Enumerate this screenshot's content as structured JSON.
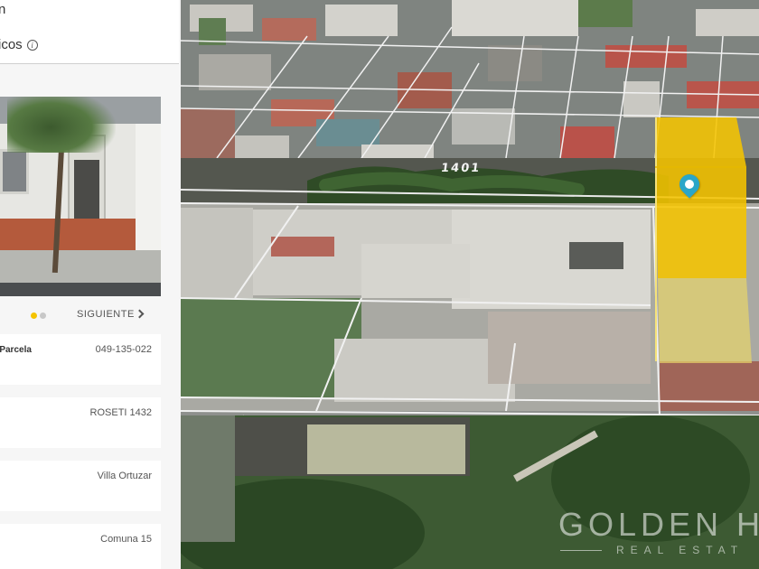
{
  "panel": {
    "title": "n",
    "subtitle": "icos",
    "info_icon": "info-icon",
    "pager": {
      "next_label": "SIGUIENTE",
      "dots": [
        {
          "color": "#f5c400"
        },
        {
          "color": "#c8c8c8"
        }
      ]
    },
    "details": [
      {
        "label": "-Parcela",
        "value": "049-135-022"
      },
      {
        "label": "",
        "value": "ROSETI 1432"
      },
      {
        "label": "",
        "value": "Villa Ortuzar"
      },
      {
        "label": "",
        "value": "Comuna 15"
      }
    ]
  },
  "map": {
    "street_label": "1401",
    "highlight_color": "#f5c400",
    "pin_color": "#2aa6c8",
    "watermark_main": "GOLDEN H",
    "watermark_sub": "REAL ESTAT"
  }
}
